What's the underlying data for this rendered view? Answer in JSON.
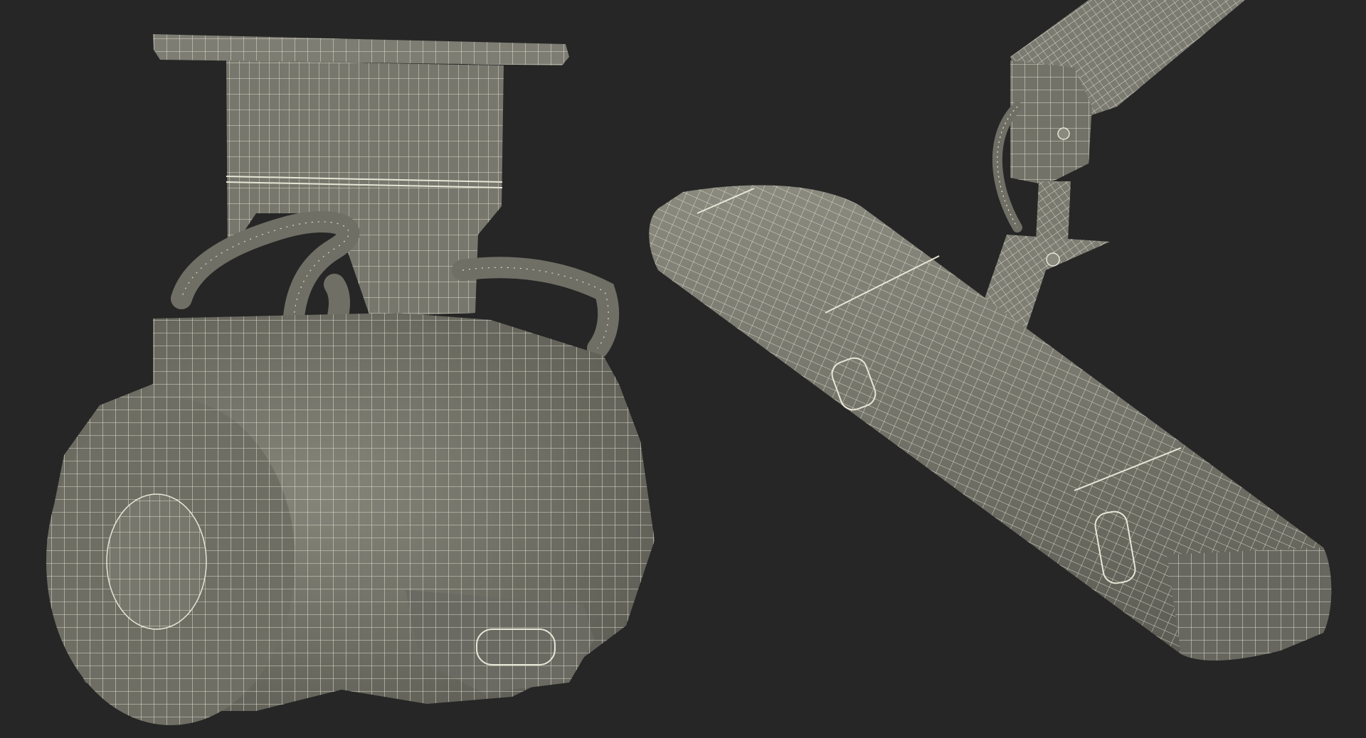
{
  "scene": {
    "background_color": "#262626",
    "mesh_fill_color": "#7a7a70",
    "mesh_shadow_color": "#5e5e56",
    "wire_color": "#e8e6d6"
  },
  "objects": [
    {
      "id": "ceiling-mount-motor-housing",
      "description_shown": false
    },
    {
      "id": "light-bar-with-articulated-arm",
      "description_shown": false
    }
  ]
}
